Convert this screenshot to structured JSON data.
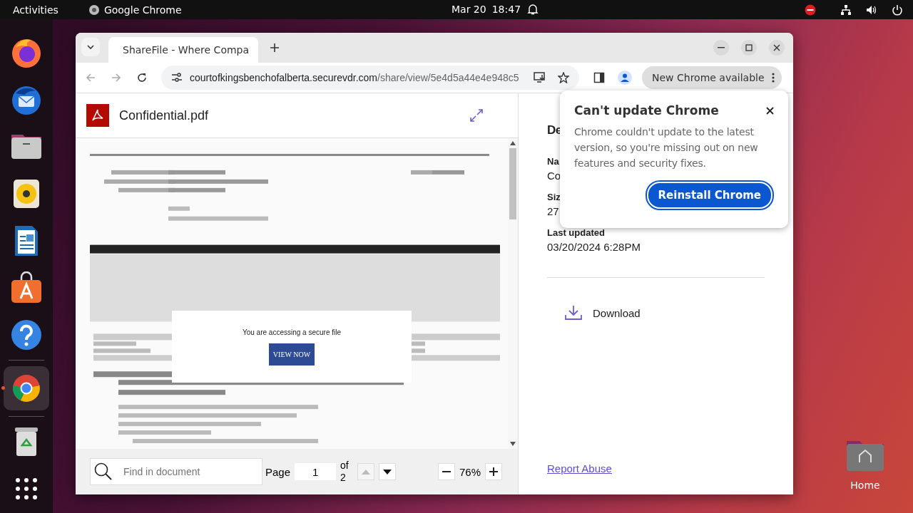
{
  "top_bar": {
    "activities": "Activities",
    "app": "Google Chrome",
    "date": "Mar 20",
    "time": "18:47"
  },
  "dock": [
    {
      "kind": "firefox",
      "running": false
    },
    {
      "kind": "thunderbird",
      "running": false
    },
    {
      "kind": "files",
      "running": false
    },
    {
      "kind": "rhythmbox",
      "running": false
    },
    {
      "kind": "writer",
      "running": false
    },
    {
      "kind": "appcenter",
      "running": false
    },
    {
      "kind": "help",
      "running": false
    },
    {
      "kind": "chrome",
      "running": true
    },
    {
      "kind": "trash",
      "running": false
    },
    {
      "kind": "grid",
      "running": false
    }
  ],
  "browser": {
    "tab": {
      "title": "ShareFile - Where Compa"
    },
    "url_host": "courtofkingsbenchofalberta.securevdr.com",
    "url_path": "/share/view/5e4d5a44e4e948c5",
    "update_chip": "New Chrome available"
  },
  "pdf": {
    "file_name": "Confidential.pdf",
    "overlay": {
      "message": "You are accessing a secure file",
      "button": "VIEW NOW"
    },
    "toolbar": {
      "find_placeholder": "Find in document",
      "page_label": "Page",
      "page": "1",
      "of": "of",
      "total": "2",
      "zoom": "76%",
      "page_buttons": [
        {
          "kind": "up",
          "disabled": true
        },
        {
          "kind": "down",
          "disabled": false
        }
      ]
    }
  },
  "details": {
    "title": "De",
    "fields": [
      {
        "label": "Na",
        "value": "Co"
      },
      {
        "label": "Siz",
        "value": "27"
      },
      {
        "label": "Last updated",
        "value": "03/20/2024 6:28PM"
      }
    ],
    "download": "Download",
    "report": "Report Abuse"
  },
  "popup": {
    "title": "Can't update Chrome",
    "body": "Chrome couldn't update to the latest version, so you're missing out on new features and security fixes.",
    "button": "Reinstall Chrome"
  },
  "desktop": {
    "home": "Home"
  }
}
